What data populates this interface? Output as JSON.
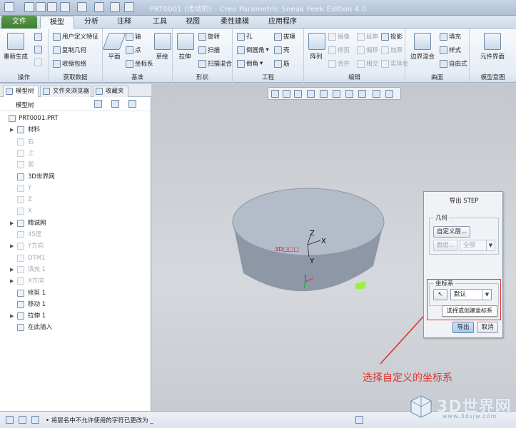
{
  "window": {
    "title": "PRT0001 (活动的) - Creo Parametric Sneak Peek Edition 4.0"
  },
  "tabs": [
    {
      "label": "文件"
    },
    {
      "label": "模型"
    },
    {
      "label": "分析"
    },
    {
      "label": "注释"
    },
    {
      "label": "工具"
    },
    {
      "label": "视图"
    },
    {
      "label": "柔性建模"
    },
    {
      "label": "应用程序"
    }
  ],
  "ribbon": {
    "operations": {
      "label": "操作",
      "regenerate": "重新生成"
    },
    "get_data": {
      "label": "获取数据",
      "user_feature": "用户定义特征",
      "copy_geometry": "复制几何",
      "shrinkwrap": "收缩包络"
    },
    "datum": {
      "label": "基准",
      "plane": "平面",
      "axis": "轴",
      "point": "点",
      "csys": "坐标系",
      "sketch": "草绘"
    },
    "shapes": {
      "label": "形状",
      "extrude": "拉伸",
      "revolve": "旋转",
      "sweep": "扫描",
      "swept_blend": "扫描混合"
    },
    "engineering": {
      "label": "工程",
      "hole": "孔",
      "round": "倒圆角",
      "chamfer": "倒角",
      "draft": "拔模",
      "shell": "壳",
      "rib": "筋"
    },
    "editing": {
      "label": "编辑",
      "pattern": "阵列",
      "mirror": "镜像",
      "trim": "修剪",
      "merge": "合并",
      "extend": "延伸",
      "offset": "偏移",
      "intersect": "相交",
      "project": "投影",
      "thicken": "加厚",
      "solidify": "实体化"
    },
    "surfaces": {
      "label": "曲面",
      "boundary_blend": "边界混合",
      "fill": "填充",
      "style": "样式",
      "freestyle": "自由式"
    },
    "model_intent": {
      "label": "模型意图",
      "component_interface": "元件界面"
    }
  },
  "left_tabs": [
    {
      "label": "模型树"
    },
    {
      "label": "文件夹浏览器"
    },
    {
      "label": "收藏夹"
    }
  ],
  "tree": {
    "header": "模型树",
    "items": [
      {
        "label": "PRT0001.PRT",
        "arrow": ""
      },
      {
        "label": "材料",
        "arrow": "▶"
      },
      {
        "label": "右",
        "arrow": ""
      },
      {
        "label": "上",
        "arrow": ""
      },
      {
        "label": "前",
        "arrow": ""
      },
      {
        "label": "3D世界网",
        "arrow": ""
      },
      {
        "label": "Y",
        "arrow": ""
      },
      {
        "label": "Z",
        "arrow": ""
      },
      {
        "label": "X",
        "arrow": ""
      },
      {
        "label": "精诚网",
        "arrow": "▶"
      },
      {
        "label": "45度",
        "arrow": ""
      },
      {
        "label": "Y方向",
        "arrow": "▶"
      },
      {
        "label": "DTM1",
        "arrow": ""
      },
      {
        "label": "填充 1",
        "arrow": "▶"
      },
      {
        "label": "X方向",
        "arrow": "▶"
      },
      {
        "label": "修剪 1",
        "arrow": ""
      },
      {
        "label": "移动 1",
        "arrow": ""
      },
      {
        "label": "拉伸 1",
        "arrow": "▶"
      },
      {
        "label": "在此插入",
        "arrow": ""
      }
    ]
  },
  "viewport": {
    "csys_label": "3D□□□",
    "axis_x": "X",
    "axis_y": "Y",
    "axis_z": "Z"
  },
  "dialog": {
    "title": "导出 STEP",
    "geometry_legend": "几何",
    "custom_layer_button": "自定义层...",
    "surface_button": "面组...",
    "all_option": "全部",
    "csys_legend": "坐标系",
    "csys_select": "默认",
    "tooltip": "选择或创建坐标系",
    "export_button": "导出",
    "cancel_button": "取消"
  },
  "annotation": "选择自定义的坐标系",
  "status": {
    "message": "• 将层名中不允许使用的字符已更改为 _"
  },
  "watermark": {
    "brand": "3D世界网",
    "url": "www.3dsjw.com"
  },
  "colors": {
    "file_tab": "#4a8a3f",
    "annotation": "#e0322f",
    "part_face": "#aeb6c4",
    "part_side": "#8e97a6"
  }
}
